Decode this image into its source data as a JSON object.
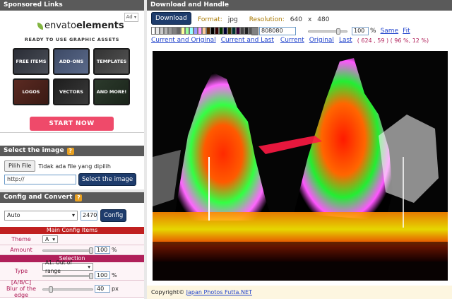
{
  "sponsored": {
    "header": "Sponsored Links",
    "ad_tag": "Ad",
    "logo_plain": "envato",
    "logo_bold": "elements",
    "tagline": "READY TO USE GRAPHIC ASSETS",
    "tiles": [
      "FREE ITEMS",
      "ADD-ONS",
      "TEMPLATES",
      "LOGOS",
      "VECTORS",
      "AND MORE!"
    ],
    "cta": "START NOW"
  },
  "select_image": {
    "header": "Select the image",
    "choose_file": "Pilih File",
    "no_file": "Tidak ada file yang dipilih",
    "url_value": "http://",
    "select_button": "Select the image"
  },
  "config": {
    "header": "Config and Convert",
    "mode": "Auto",
    "size_value": "2470",
    "config_button": "Config",
    "main_title": "Main Config Items",
    "theme_label": "Theme",
    "theme_value": "A",
    "amount_label": "Amount",
    "amount_value": "100",
    "amount_level": 1.0,
    "amount_unit": "%",
    "selection_title": "Selection",
    "type_label": "Type",
    "type_value": "A1: Out of range",
    "type_pct_value": "100",
    "type_level": 1.0,
    "type_unit": "%",
    "blur_label_1": "[A/B/C]",
    "blur_label_2": "Blur of the edge",
    "blur_value": "40",
    "blur_level": 0.13,
    "blur_unit": "px"
  },
  "download": {
    "header": "Download and Handle",
    "download_button": "Download",
    "format_label": "Format:",
    "format_value": "jpg",
    "resolution_label": "Resolution:",
    "res_w": "640",
    "res_x": "x",
    "res_h": "480",
    "hex_value": "808080",
    "zoom_value": "100",
    "zoom_level": 0.8,
    "zoom_unit": "%",
    "link_same": "Same",
    "link_fit": "Fit",
    "link_current_original": "Current and Original",
    "link_current_last": "Current and Last",
    "link_current": "Current",
    "link_original": "Original",
    "link_last": "Last",
    "coords_text": "( 624 , 59 ) ( 96 %, 12 %)",
    "swatch_colors": [
      "#ffffff",
      "#e6e6e6",
      "#cccccc",
      "#b3b3b3",
      "#999999",
      "#808080",
      "#666666",
      "#ffff99",
      "#99ff99",
      "#99ffff",
      "#9999ff",
      "#ff99ff",
      "#ffcc99",
      "#663300",
      "#000000",
      "#330000",
      "#003300",
      "#000033",
      "#333300",
      "#003333",
      "#330033",
      "#444444",
      "#222222",
      "#555555",
      "#111111"
    ],
    "footer_text": "Copyright©",
    "footer_link": "Japan Photos Futta.NET"
  },
  "colors": {
    "header_bg": "#5a5a5a",
    "accent_red": "#c02020",
    "accent_magenta": "#b0205a",
    "button_dark": "#1e3c6c",
    "cta_pink": "#ef4a6a"
  }
}
